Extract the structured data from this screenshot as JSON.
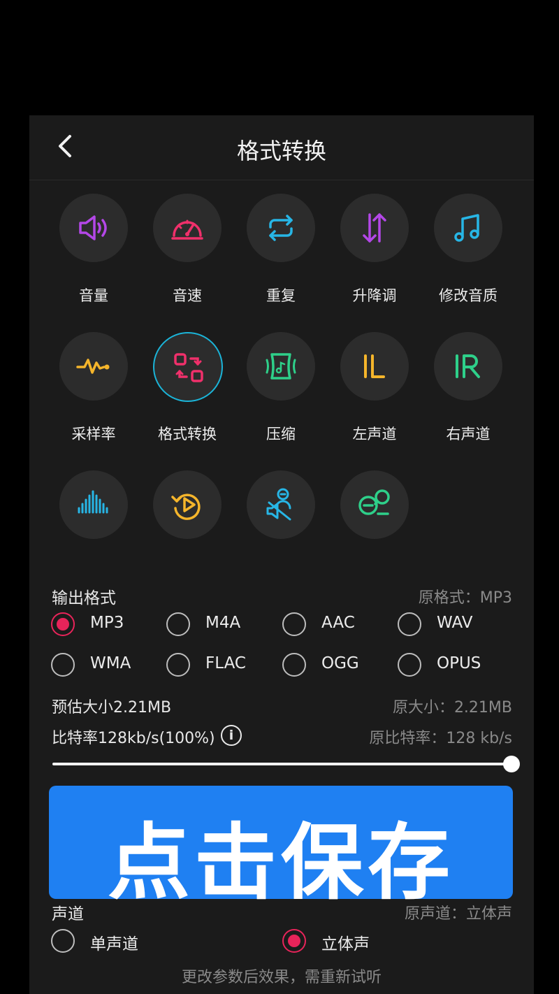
{
  "header": {
    "title": "格式转换"
  },
  "tools": [
    {
      "label": "音量",
      "icon": "speaker-icon",
      "color": "#b447e8"
    },
    {
      "label": "音速",
      "icon": "speedometer-icon",
      "color": "#f0306b"
    },
    {
      "label": "重复",
      "icon": "repeat-icon",
      "color": "#27b6e6"
    },
    {
      "label": "升降调",
      "icon": "pitch-arrows-icon",
      "color": "#b447e8"
    },
    {
      "label": "修改音质",
      "icon": "music-note-icon",
      "color": "#27b6e6"
    },
    {
      "label": "采样率",
      "icon": "waveform-icon",
      "color": "#f5b52b"
    },
    {
      "label": "格式转换",
      "icon": "format-convert-icon",
      "color": "#f0306b"
    },
    {
      "label": "压缩",
      "icon": "compress-icon",
      "color": "#2ed08a"
    },
    {
      "label": "左声道",
      "icon": "left-channel-icon",
      "color": "#f5b52b"
    },
    {
      "label": "右声道",
      "icon": "right-channel-icon",
      "color": "#2ed08a"
    },
    {
      "label": "",
      "icon": "equalizer-bars-icon",
      "color": "#27b6e6"
    },
    {
      "label": "",
      "icon": "reverse-play-icon",
      "color": "#f5b52b"
    },
    {
      "label": "",
      "icon": "remove-vocals-icon",
      "color": "#27b6e6"
    },
    {
      "label": "",
      "icon": "microphone-icon",
      "color": "#2ed08a"
    }
  ],
  "output": {
    "label": "输出格式",
    "original": "原格式：MP3",
    "formats": [
      "MP3",
      "M4A",
      "AAC",
      "WAV",
      "WMA",
      "FLAC",
      "OGG",
      "OPUS"
    ],
    "selected": "MP3"
  },
  "size": {
    "estimate": "预估大小2.21MB",
    "original": "原大小：2.21MB"
  },
  "bitrate": {
    "label": "比特率128kb/s(100%)",
    "original": "原比特率：128 kb/s",
    "info_glyph": "i",
    "fraction": 1.0
  },
  "save_button": {
    "label": "点击保存"
  },
  "channel": {
    "label": "声道",
    "original": "原声道：立体声",
    "options": [
      "单声道",
      "立体声"
    ],
    "selected": "立体声"
  },
  "hint": "更改参数后效果，需重新试听",
  "colors": {
    "accent": "#e8245a",
    "button": "#1f80f2",
    "highlight": "#1bb4d8"
  }
}
